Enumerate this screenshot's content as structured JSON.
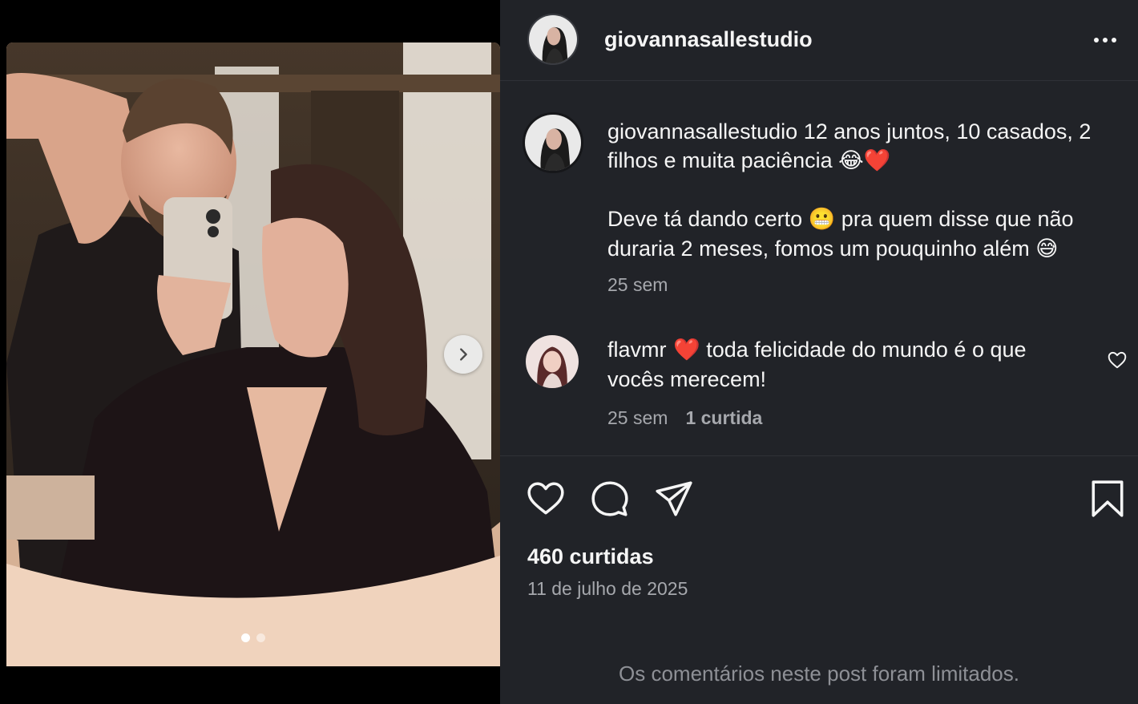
{
  "post": {
    "author": "giovannasallestudio",
    "media": {
      "slide_count": 2,
      "active_slide": 1,
      "next_icon": "chevron-right-icon"
    }
  },
  "caption": {
    "username": "giovannasallestudio",
    "line1": " 12 anos juntos, 10 casados, 2 filhos e muita paciência ",
    "emoji1": "😂❤️",
    "line2a": "Deve tá dando certo ",
    "emoji2": "😬",
    "line2b": " pra quem disse que não duraria 2 meses, fomos um pouquinho além ",
    "emoji3": "😅",
    "time": "25 sem"
  },
  "comment": {
    "username": "flavmr",
    "emoji": " ❤️",
    "text": " toda felicidade do mundo é o que vocês merecem!",
    "time": "25 sem",
    "likes": "1 curtida"
  },
  "actions": {
    "icons": [
      "heart-icon",
      "comment-icon",
      "share-icon",
      "bookmark-icon"
    ],
    "likes_count": "460 curtidas",
    "date": "11 de julho de 2025"
  },
  "footer": {
    "limited_notice": "Os comentários neste post foram limitados."
  },
  "colors": {
    "panel_bg": "#212328",
    "text": "#f5f5f5",
    "muted": "#a6a8ad",
    "heart_red": "#e8263a"
  }
}
